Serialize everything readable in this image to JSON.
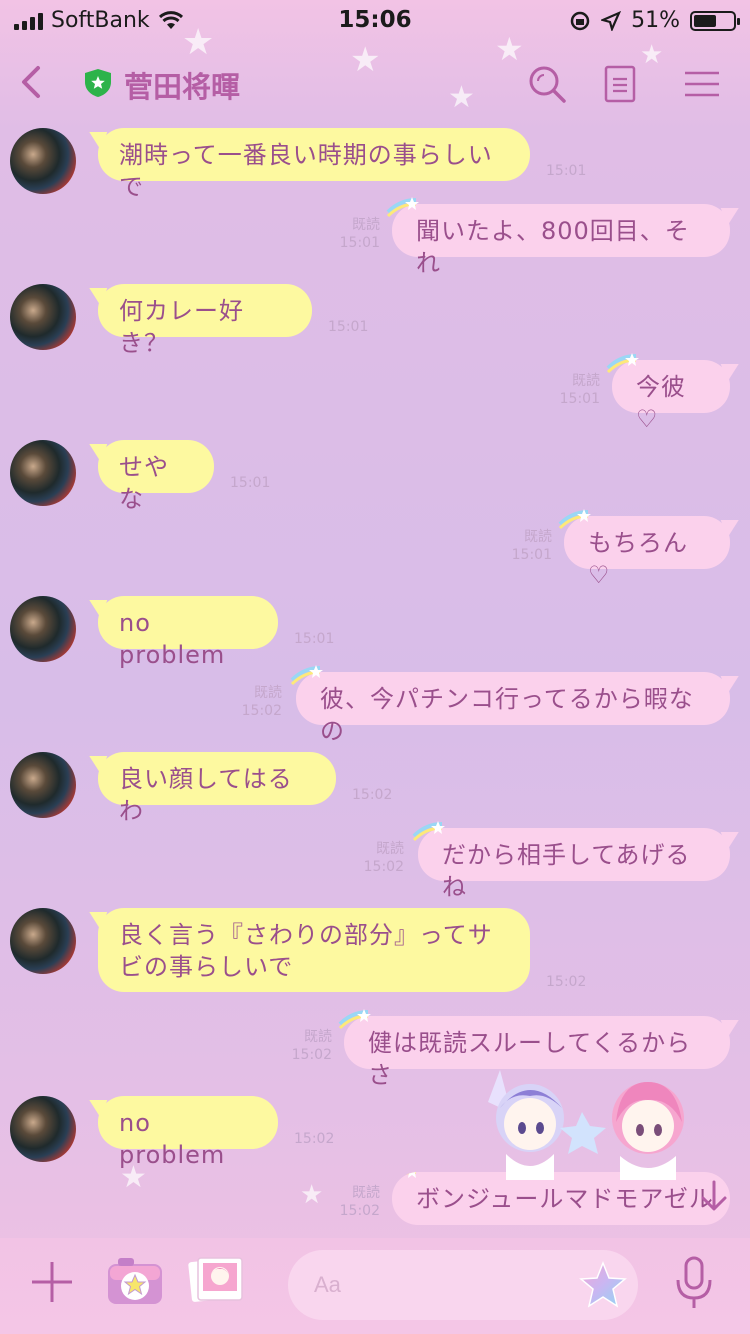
{
  "status_bar": {
    "carrier": "SoftBank",
    "time": "15:06",
    "battery": "51%",
    "battery_fraction": 0.51
  },
  "header": {
    "contact_name": "菅田将暉"
  },
  "messages": [
    {
      "side": "in",
      "text": "潮時って一番良い時期の事らしいで",
      "time": "15:01"
    },
    {
      "side": "out",
      "text": "聞いたよ、800回目、それ",
      "read": "既読",
      "time": "15:01"
    },
    {
      "side": "in",
      "text": "何カレー好き？",
      "time": "15:01"
    },
    {
      "side": "out",
      "text": "今彼♡",
      "read": "既読",
      "time": "15:01"
    },
    {
      "side": "in",
      "text": "せやな",
      "time": "15:01"
    },
    {
      "side": "out",
      "text": "もちろん♡",
      "read": "既読",
      "time": "15:01"
    },
    {
      "side": "in",
      "text": "no problem",
      "time": "15:01"
    },
    {
      "side": "out",
      "text": "彼、今パチンコ行ってるから暇なの",
      "read": "既読",
      "time": "15:02"
    },
    {
      "side": "in",
      "text": "良い顔してはるわ",
      "time": "15:02"
    },
    {
      "side": "out",
      "text": "だから相手してあげるね",
      "read": "既読",
      "time": "15:02"
    },
    {
      "side": "in",
      "text": "良く言う『さわりの部分』ってサビの事らしいで",
      "time": "15:02"
    },
    {
      "side": "out",
      "text": "健は既読スルーしてくるからさ",
      "read": "既読",
      "time": "15:02"
    },
    {
      "side": "in",
      "text": "no problem",
      "time": "15:02"
    },
    {
      "side": "out",
      "text": "ボンジュールマドモアゼル",
      "read": "既読",
      "time": "15:02"
    }
  ],
  "footer": {
    "input_placeholder": "Aa"
  },
  "icons": {
    "back": "chevron-left-icon",
    "verified": "shield-star-icon",
    "search": "search-icon",
    "notes": "notes-icon",
    "menu": "menu-icon",
    "add": "plus-icon",
    "camera": "camera-icon",
    "photos": "photos-icon",
    "sticker": "star-sticker-icon",
    "mic": "mic-icon",
    "scroll_down": "arrow-down-icon"
  },
  "colors": {
    "accent": "#b55ea5",
    "incoming_bubble": "#fdf9a0",
    "outgoing_bubble": "#fbd1ec",
    "text": "#9a4f8c",
    "verified_green": "#2db34a"
  }
}
